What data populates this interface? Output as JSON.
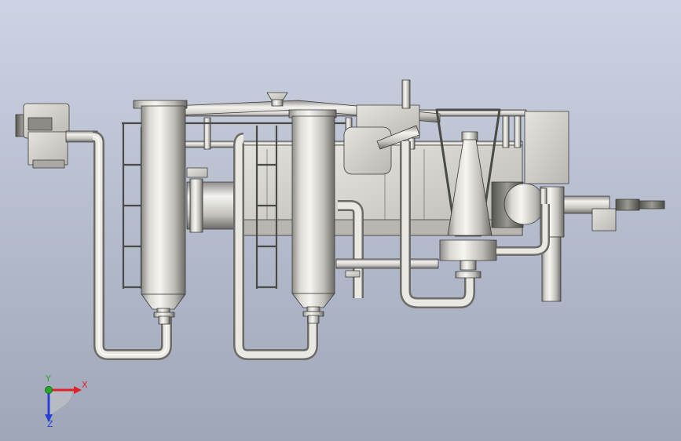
{
  "viewport": {
    "background_top": "#cdd3e2",
    "background_bottom": "#9ea6b8"
  },
  "model": {
    "metal_light": "#f4f3ef",
    "metal_mid": "#c9c8c3",
    "metal_dark": "#6f6e6a",
    "edge": "#3a3a3a"
  },
  "triad": {
    "x_label": "X",
    "y_label": "Y",
    "z_label": "Z",
    "x_color": "#e0202a",
    "y_color": "#2aa52a",
    "z_color": "#2a3fd6"
  }
}
